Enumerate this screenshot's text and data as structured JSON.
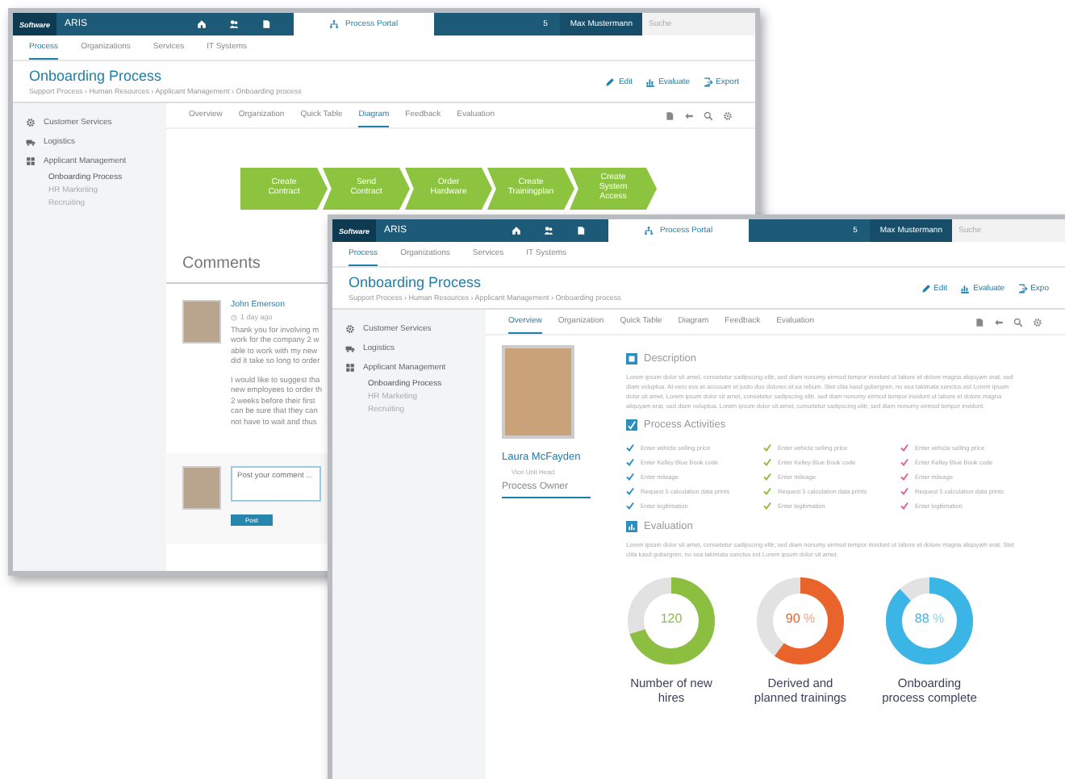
{
  "windows": [
    {
      "kind": "diagram",
      "topbar": {
        "logo": "Software",
        "product": "ARIS",
        "portal_tab": "Process Portal",
        "count": "5",
        "user": "Max Mustermann",
        "search": {
          "placeholder": "Suche"
        }
      },
      "nav": [
        {
          "label": "Process",
          "selected": true
        },
        {
          "label": "Organizations",
          "selected": false
        },
        {
          "label": "Services",
          "selected": false
        },
        {
          "label": "IT Systems",
          "selected": false
        }
      ],
      "title": "Onboarding Process",
      "breadcrumb": "Support Process › Human Resources › Applicant Management › Onboarding process",
      "actions": [
        "Edit",
        "Evaluate",
        "Export"
      ],
      "sidebar": [
        {
          "label": "Customer Services"
        },
        {
          "label": "Logistics"
        },
        {
          "label": "Applicant Management",
          "children": [
            {
              "label": "Onboarding Process",
              "selected": true
            },
            {
              "label": "HR Marketing",
              "selected": false
            },
            {
              "label": "Recruiting",
              "selected": false
            }
          ]
        }
      ],
      "tabs": [
        {
          "label": "Overview",
          "selected": false
        },
        {
          "label": "Organization",
          "selected": false
        },
        {
          "label": "Quick Table",
          "selected": false
        },
        {
          "label": "Diagram",
          "selected": true
        },
        {
          "label": "Feedback",
          "selected": false
        },
        {
          "label": "Evaluation",
          "selected": false
        }
      ],
      "diagram": {
        "steps": [
          "Create Contract",
          "Send Contract",
          "Order Hardware",
          "Create Trainingplan",
          "Create System Access"
        ]
      },
      "comments": {
        "title": "Comments",
        "items": [
          {
            "author": "John Emerson",
            "time": "1 day ago",
            "paragraphs": [
              "Thank you for involving m\nwork for the company 2 w\nable to work with my new\ndid it take so long to order",
              "I would like to suggest tha\nnew employees to order th\n2 weeks before their first\ncan be sure that they can\nnot have to wait and thus"
            ]
          }
        ],
        "input": {
          "placeholder": "Post your comment ..."
        },
        "post_button": "Post"
      }
    },
    {
      "kind": "overview",
      "topbar": {
        "logo": "Software",
        "product": "ARIS",
        "portal_tab": "Process Portal",
        "count": "5",
        "user": "Max Mustermann",
        "search": {
          "placeholder": "Suche"
        }
      },
      "nav": [
        {
          "label": "Process",
          "selected": true
        },
        {
          "label": "Organizations",
          "selected": false
        },
        {
          "label": "Services",
          "selected": false
        },
        {
          "label": "IT Systems",
          "selected": false
        }
      ],
      "title": "Onboarding Process",
      "breadcrumb": "Support Process › Human Resources › Applicant Management › Onboarding process",
      "actions": [
        "Edit",
        "Evaluate",
        "Expo"
      ],
      "sidebar": [
        {
          "label": "Customer Services"
        },
        {
          "label": "Logistics"
        },
        {
          "label": "Applicant Management",
          "children": [
            {
              "label": "Onboarding Process",
              "selected": true
            },
            {
              "label": "HR Marketing",
              "selected": false
            },
            {
              "label": "Recruiting",
              "selected": false
            }
          ]
        }
      ],
      "tabs": [
        {
          "label": "Overview",
          "selected": true
        },
        {
          "label": "Organization",
          "selected": false
        },
        {
          "label": "Quick Table",
          "selected": false
        },
        {
          "label": "Diagram",
          "selected": false
        },
        {
          "label": "Feedback",
          "selected": false
        },
        {
          "label": "Evaluation",
          "selected": false
        }
      ],
      "owner": {
        "name": "Laura McFayden",
        "role": "Vice Unit Head",
        "caption": "Process Owner"
      },
      "description": {
        "title": "Description",
        "text": "Lorem ipsum dolor sit amet, consetetur sadipscing elitr, sed diam nonumy eirmod tempor invidunt ut labore et dolore magna aliquyam erat, sed diam voluptua. At vero eos et accusam et justo duo dolores et ea rebum. Stet clita kasd gubergren, no sea takimata sanctus est Lorem ipsum dolor sit amet. Lorem ipsum dolor sit amet, consetetur sadipscing elitr, sed diam nonumy eirmod tempor invidunt ut labore et dolore magna aliquyam erat, sed diam voluptua. Lorem ipsum dolor sit amet, consetetur sadipscing elitr, sed diam nonumy eirmod tempor invidunt."
      },
      "activities": {
        "title": "Process Activities",
        "columns": [
          {
            "color": "#2b8fc9",
            "items": [
              "Enter vehicle selling price",
              "Enter Kelley Blue Book code",
              "Enter mileage",
              "Request 5 calculation data prints",
              "Enter legitimation"
            ]
          },
          {
            "color": "#8cbf3f",
            "items": [
              "Enter vehicle selling price",
              "Enter Kelley Blue Book code",
              "Enter mileage",
              "Request 5 calculation data prints",
              "Enter legitimation"
            ]
          },
          {
            "color": "#e0609a",
            "items": [
              "Enter vehicle selling price",
              "Enter Kelley Blue Book code",
              "Enter mileage",
              "Request 5 calculation data prints",
              "Enter legitimation"
            ]
          }
        ]
      },
      "evaluation": {
        "title": "Evaluation",
        "text": "Lorem ipsum dolor sit amet, consetetur sadipscing elitr, sed diam nonumy eirmod tempor invidunt ut labore et dolore magna aliquyam erat. Stet clita kasd gubergren, no sea takimata sanctus est Lorem ipsum dolor sit amet.",
        "gauges": [
          {
            "value": "120",
            "level": 0.7,
            "color": "#8cbf3f",
            "label": "Number of new hires"
          },
          {
            "value": "90",
            "unit": "%",
            "level": 0.6,
            "color": "#e8642a",
            "label": "Derived and planned trainings"
          },
          {
            "value": "88",
            "unit": "%",
            "level": 0.88,
            "color": "#3bb5e6",
            "label": "Onboarding process complete"
          }
        ]
      }
    }
  ]
}
